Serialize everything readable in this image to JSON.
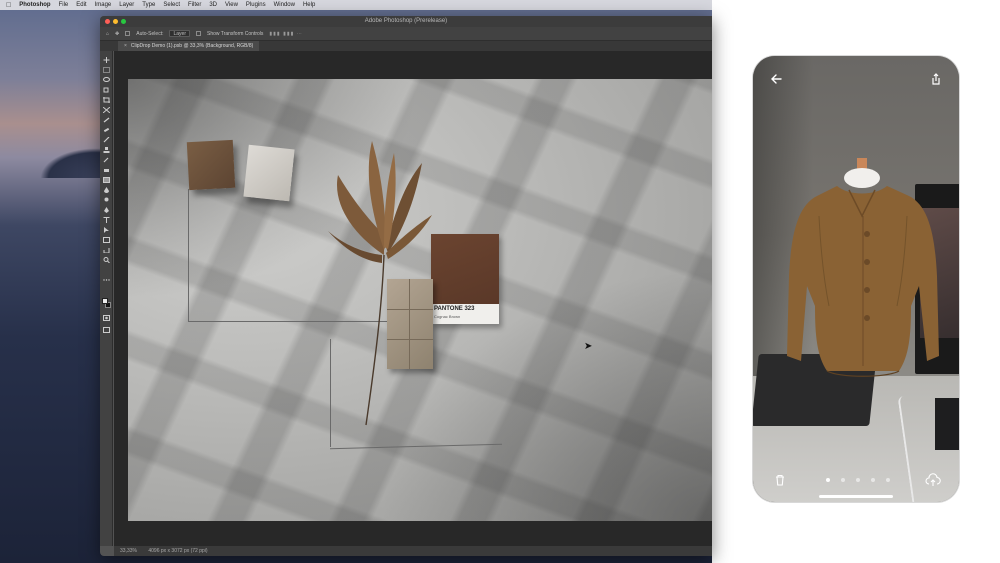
{
  "menubar": {
    "app_name": "Photoshop",
    "items": [
      "File",
      "Edit",
      "Image",
      "Layer",
      "Type",
      "Select",
      "Filter",
      "3D",
      "View",
      "Plugins",
      "Window",
      "Help"
    ]
  },
  "photoshop": {
    "window_title": "Adobe Photoshop (Prerelease)",
    "options_bar": {
      "auto_select_label": "Auto-Select:",
      "layer_dropdown": "Layer",
      "transform_controls_label": "Show Transform Controls"
    },
    "document_tab": "ClipDrop Demo (1).psb @ 33,3% (Background, RGB/8)",
    "status_bar": {
      "zoom": "33,33%",
      "doc_size": "4096 px x 3072 px (72 ppi)"
    },
    "canvas": {
      "pantone_code": "PANTONE 323",
      "pantone_name": "Cognac Brown"
    }
  },
  "phone": {
    "back_icon": "arrow-left-icon",
    "share_icon": "share-icon",
    "delete_icon": "trash-icon",
    "upload_icon": "cloud-upload-icon",
    "pager": {
      "count": 5,
      "active_index": 0
    }
  },
  "colors": {
    "ps_chrome": "#535353",
    "pantone_brown": "#6b4430",
    "jacket_brown": "#8a6234"
  }
}
